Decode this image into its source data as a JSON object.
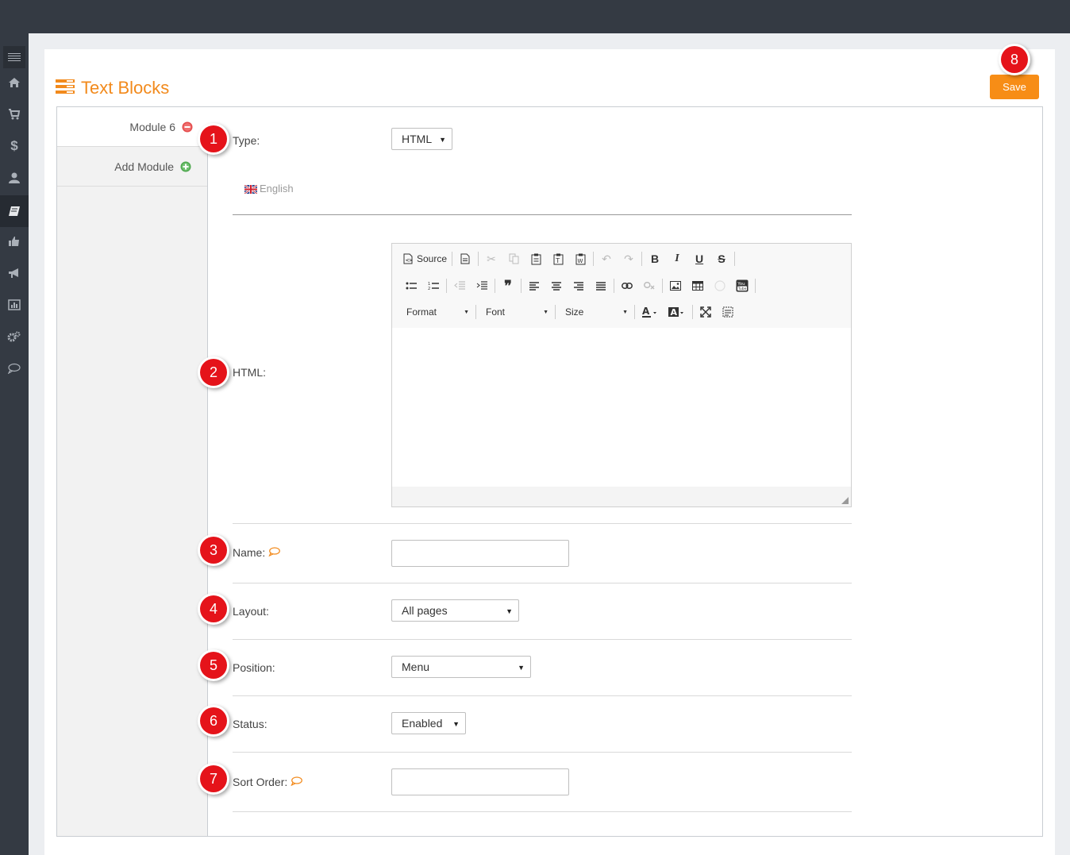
{
  "header": {
    "title": "Text Blocks",
    "save_label": "Save"
  },
  "sidebar": {
    "items": [
      {
        "name": "menu-icon"
      },
      {
        "name": "home-icon"
      },
      {
        "name": "cart-icon"
      },
      {
        "name": "dollar-icon"
      },
      {
        "name": "user-icon"
      },
      {
        "name": "book-icon",
        "active": true
      },
      {
        "name": "thumbs-up-icon"
      },
      {
        "name": "megaphone-icon"
      },
      {
        "name": "bar-chart-icon"
      },
      {
        "name": "gears-icon"
      },
      {
        "name": "chat-icon"
      }
    ]
  },
  "tabs": [
    {
      "label": "Module 6",
      "icon": "remove-icon"
    },
    {
      "label": "Add Module",
      "icon": "add-icon"
    }
  ],
  "form": {
    "type": {
      "label": "Type:",
      "value": "HTML"
    },
    "language": "English",
    "html": {
      "label": "HTML:"
    },
    "name": {
      "label": "Name:",
      "value": ""
    },
    "layout": {
      "label": "Layout:",
      "value": "All pages"
    },
    "position": {
      "label": "Position:",
      "value": "Menu"
    },
    "status": {
      "label": "Status:",
      "value": "Enabled"
    },
    "sort_order": {
      "label": "Sort Order:",
      "value": ""
    }
  },
  "editor": {
    "source_label": "Source",
    "format_label": "Format",
    "font_label": "Font",
    "size_label": "Size"
  },
  "badges": [
    "1",
    "2",
    "3",
    "4",
    "5",
    "6",
    "7",
    "8"
  ],
  "colors": {
    "accent": "#f28a1c",
    "save": "#f78d16",
    "badge": "#e5131a",
    "topbar": "#343a43"
  }
}
